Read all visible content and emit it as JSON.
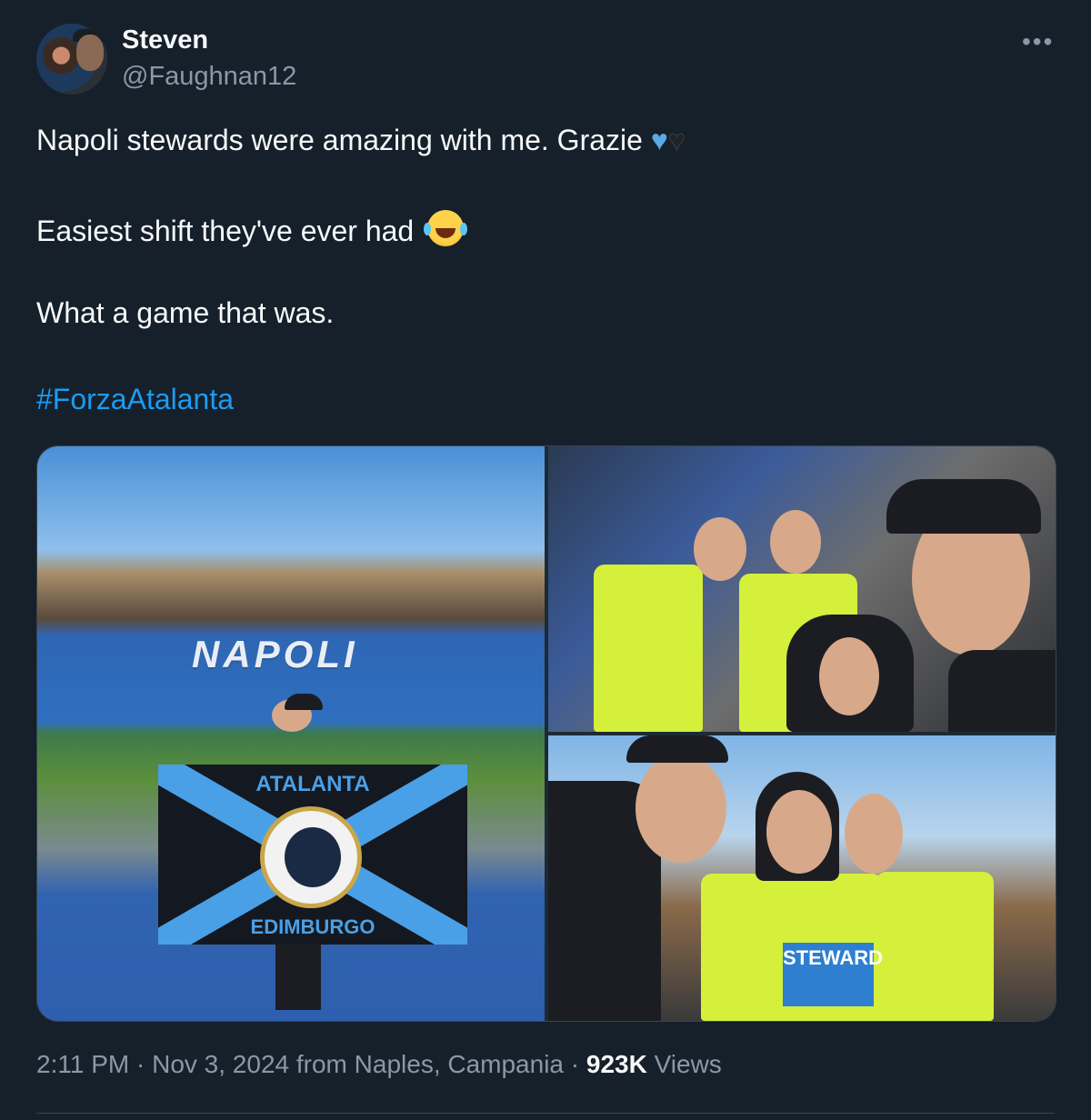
{
  "author": {
    "name": "Steven",
    "handle": "@Faughnan12"
  },
  "menu": {
    "more_label": "•••"
  },
  "tweet": {
    "line1": "Napoli stewards were amazing with me. Grazie",
    "line2": "Easiest shift they've ever had",
    "line3": "What a game that was.",
    "hashtag": "#ForzaAtalanta"
  },
  "emoji": {
    "blue_heart": "♥",
    "black_heart": "♥"
  },
  "media": {
    "stadium_sign": "NAPOLI",
    "flag_top": "ATALANTA",
    "flag_bottom": "EDIMBURGO",
    "vest_tag": "STEWARD"
  },
  "footer": {
    "time": "2:11 PM",
    "date": "Nov 3, 2024",
    "location": "from Naples, Campania",
    "views_count": "923K",
    "views_label": "Views",
    "separator": "·"
  },
  "colors": {
    "background": "#15202b",
    "text": "#f7f9f9",
    "muted": "#8b98a5",
    "link": "#1d9bf0",
    "border": "#38444d"
  }
}
